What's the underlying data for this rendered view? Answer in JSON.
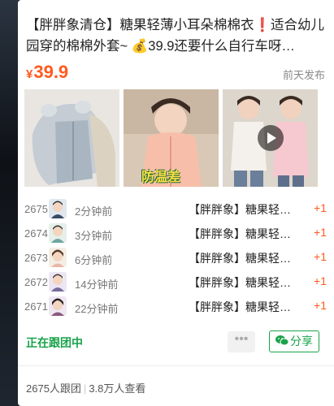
{
  "post": {
    "title": "【胖胖象清仓】糖果轻薄小耳朵棉棉衣❗适合幼儿园穿的棉棉外套~ 💰39.9还要什么自行车呀…",
    "currency": "¥",
    "price": "39.9",
    "published": "前天发布"
  },
  "images": {
    "thumb2_caption": "防温差"
  },
  "group_buys": [
    {
      "no": "2675",
      "ago": "2分钟前",
      "item": "【胖胖象】糖果轻…",
      "plus": "+1"
    },
    {
      "no": "2674",
      "ago": "3分钟前",
      "item": "【胖胖象】糖果轻…",
      "plus": "+1"
    },
    {
      "no": "2673",
      "ago": "6分钟前",
      "item": "【胖胖象】糖果轻…",
      "plus": "+1"
    },
    {
      "no": "2672",
      "ago": "14分钟前",
      "item": "【胖胖象】糖果轻…",
      "plus": "+1"
    },
    {
      "no": "2671",
      "ago": "22分钟前",
      "item": "【胖胖象】糖果轻…",
      "plus": "+1"
    }
  ],
  "actions": {
    "status": "正在跟团中",
    "more": "•••",
    "share": "分享"
  },
  "footer": {
    "followers": "2675人跟团",
    "views": "3.8万人查看"
  },
  "colors": {
    "price": "#ff5a1f",
    "accent_green": "#19a34a"
  }
}
